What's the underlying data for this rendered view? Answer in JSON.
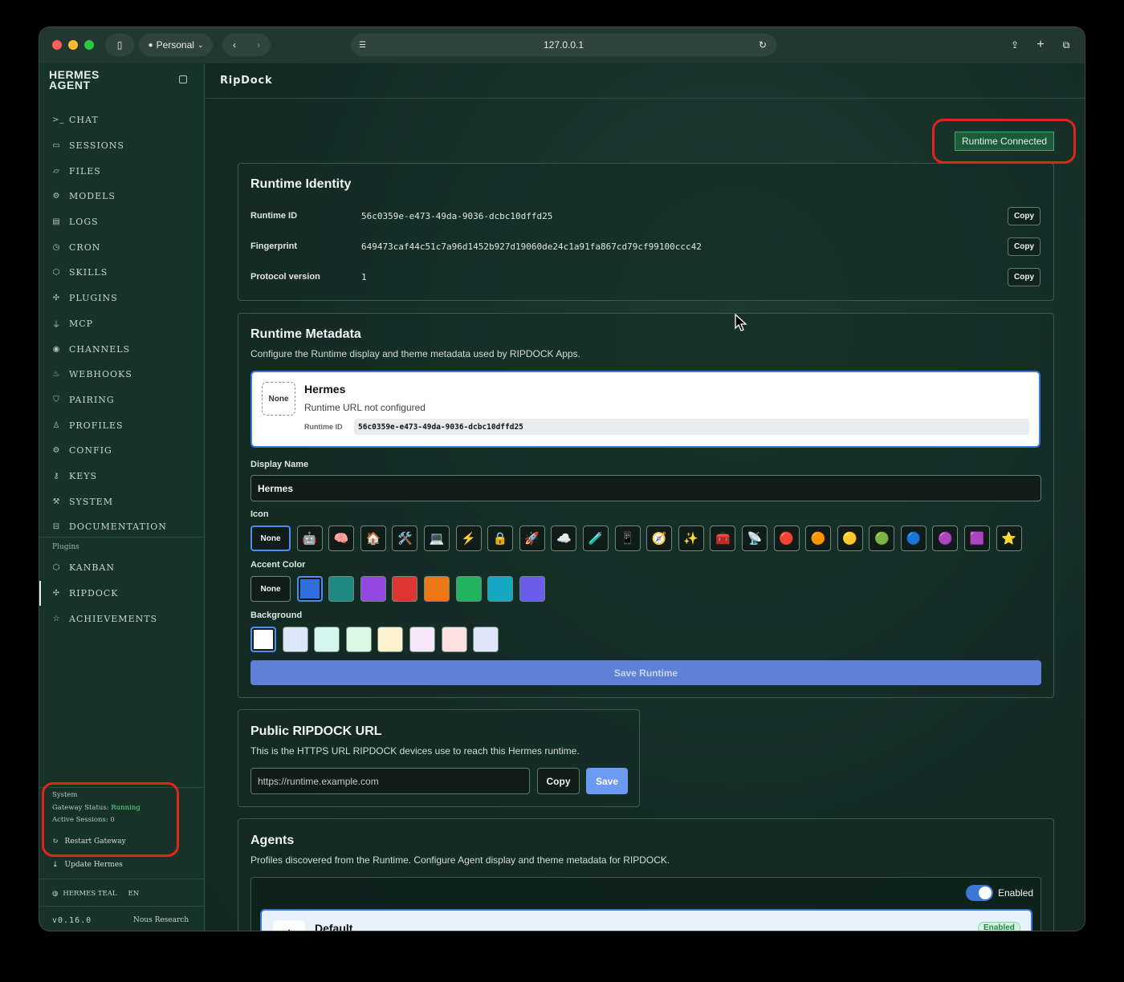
{
  "browser": {
    "profile": "Personal",
    "url": "127.0.0.1"
  },
  "sidebar": {
    "brand_line1": "HERMES",
    "brand_line2": "AGENT",
    "nav": [
      {
        "label": "CHAT",
        "icon": "terminal-icon"
      },
      {
        "label": "SESSIONS",
        "icon": "chat-bubble-icon"
      },
      {
        "label": "FILES",
        "icon": "folder-icon"
      },
      {
        "label": "MODELS",
        "icon": "cube-icon"
      },
      {
        "label": "LOGS",
        "icon": "document-icon"
      },
      {
        "label": "CRON",
        "icon": "clock-icon"
      },
      {
        "label": "SKILLS",
        "icon": "package-icon"
      },
      {
        "label": "PLUGINS",
        "icon": "puzzle-icon"
      },
      {
        "label": "MCP",
        "icon": "plug-icon"
      },
      {
        "label": "CHANNELS",
        "icon": "broadcast-icon"
      },
      {
        "label": "WEBHOOKS",
        "icon": "webhook-icon"
      },
      {
        "label": "PAIRING",
        "icon": "shield-icon"
      },
      {
        "label": "PROFILES",
        "icon": "users-icon"
      },
      {
        "label": "CONFIG",
        "icon": "gear-icon"
      },
      {
        "label": "KEYS",
        "icon": "key-icon"
      },
      {
        "label": "SYSTEM",
        "icon": "wrench-icon"
      },
      {
        "label": "DOCUMENTATION",
        "icon": "book-icon"
      }
    ],
    "plugins_label": "Plugins",
    "plugins": [
      {
        "label": "KANBAN",
        "icon": "package-icon"
      },
      {
        "label": "RIPDOCK",
        "icon": "puzzle-icon",
        "active": true
      },
      {
        "label": "ACHIEVEMENTS",
        "icon": "star-icon"
      }
    ],
    "system": {
      "title": "System",
      "gateway_label": "Gateway Status:",
      "gateway_value": "Running",
      "sessions_label": "Active Sessions:",
      "sessions_value": "0",
      "restart": "Restart Gateway",
      "update": "Update Hermes",
      "theme": "HERMES TEAL",
      "lang": "EN",
      "version": "v0.16.0",
      "vendor": "Nous Research"
    }
  },
  "main": {
    "title": "RipDock",
    "connection_badge": "Runtime Connected",
    "identity": {
      "heading": "Runtime Identity",
      "rows": [
        {
          "label": "Runtime ID",
          "value": "56c0359e-e473-49da-9036-dcbc10dffd25",
          "action": "Copy"
        },
        {
          "label": "Fingerprint",
          "value": "649473caf44c51c7a96d1452b927d19060de24c1a91fa867cd79cf99100ccc42",
          "action": "Copy"
        },
        {
          "label": "Protocol version",
          "value": "1",
          "action": "Copy"
        }
      ]
    },
    "metadata": {
      "heading": "Runtime Metadata",
      "description": "Configure the Runtime display and theme metadata used by RIPDOCK Apps.",
      "preview": {
        "icon_placeholder": "None",
        "name": "Hermes",
        "url_status": "Runtime URL not configured",
        "id_label": "Runtime ID",
        "id_value": "56c0359e-e473-49da-9036-dcbc10dffd25"
      },
      "display_name_label": "Display Name",
      "display_name_value": "Hermes",
      "icon_label": "Icon",
      "icons": [
        "None",
        "🤖",
        "🧠",
        "🏠",
        "🛠️",
        "💻",
        "⚡",
        "🔒",
        "🚀",
        "☁️",
        "🧪",
        "📱",
        "🧭",
        "✨",
        "🧰",
        "📡",
        "🔴",
        "🟠",
        "🟡",
        "🟢",
        "🔵",
        "🟣",
        "🟪",
        "⭐"
      ],
      "accent_label": "Accent Color",
      "accent_none": "None",
      "accents": [
        "#2f6fe0",
        "#1f8a82",
        "#9247e0",
        "#de3434",
        "#ee7716",
        "#22b35e",
        "#15a8c2",
        "#6b5ee6"
      ],
      "background_label": "Background",
      "backgrounds": [
        "#ffffff",
        "#dde6f9",
        "#d3f7ee",
        "#dcf7e4",
        "#fdf2d0",
        "#f7e6fa",
        "#fde0e0",
        "#e0e6fa"
      ],
      "save_label": "Save Runtime"
    },
    "public_url": {
      "heading": "Public RIPDOCK URL",
      "description": "This is the HTTPS URL RIPDOCK devices use to reach this Hermes runtime.",
      "placeholder": "https://runtime.example.com",
      "copy_label": "Copy",
      "save_label": "Save"
    },
    "agents": {
      "heading": "Agents",
      "description": "Profiles discovered from the Runtime. Configure Agent display and theme metadata for RIPDOCK.",
      "toggle_label": "Enabled",
      "first_agent": "Default",
      "first_agent_badge": "Enabled"
    }
  }
}
